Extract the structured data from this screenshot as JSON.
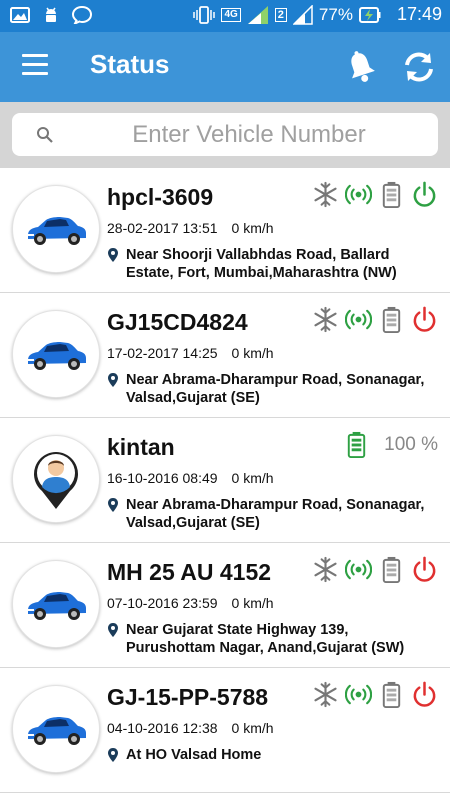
{
  "status_bar": {
    "battery_percent": "77%",
    "time": "17:49",
    "network": "4G",
    "sim2": "2"
  },
  "app_bar": {
    "title": "Status"
  },
  "search": {
    "placeholder": "Enter Vehicle Number"
  },
  "vehicles": [
    {
      "name": "hpcl-3609",
      "datetime": "28-02-2017 13:51",
      "speed": "0 km/h",
      "address": "Near Shoorji Vallabhdas Road, Ballard Estate, Fort, Mumbai,Maharashtra (NW)",
      "type": "car",
      "power": "on"
    },
    {
      "name": "GJ15CD4824",
      "datetime": "17-02-2017 14:25",
      "speed": "0 km/h",
      "address": "Near Abrama-Dharampur Road, Sonanagar, Valsad,Gujarat (SE)",
      "type": "car",
      "power": "off"
    },
    {
      "name": "kintan",
      "datetime": "16-10-2016 08:49",
      "speed": "0 km/h",
      "address": "Near Abrama-Dharampur Road, Sonanagar, Valsad,Gujarat (SE)",
      "type": "person",
      "battery": "100 %"
    },
    {
      "name": "MH 25 AU 4152",
      "datetime": "07-10-2016 23:59",
      "speed": "0 km/h",
      "address": "Near Gujarat State Highway 139, Purushottam Nagar, Anand,Gujarat (SW)",
      "type": "car",
      "power": "off"
    },
    {
      "name": "GJ-15-PP-5788",
      "datetime": "04-10-2016 12:38",
      "speed": "0 km/h",
      "address": "At HO Valsad Home",
      "type": "car",
      "power": "off"
    }
  ],
  "icons": {
    "ac": "snowflake-icon",
    "signal": "signal-broadcast-icon",
    "battery": "battery-icon",
    "power": "power-icon",
    "location_pin": "map-pin-icon"
  },
  "colors": {
    "status_bar": "#1e7fcf",
    "app_bar": "#3d94d8",
    "power_on": "#2ea043",
    "power_off": "#e03030",
    "signal": "#2ea043",
    "battery_full": "#2ea043"
  }
}
